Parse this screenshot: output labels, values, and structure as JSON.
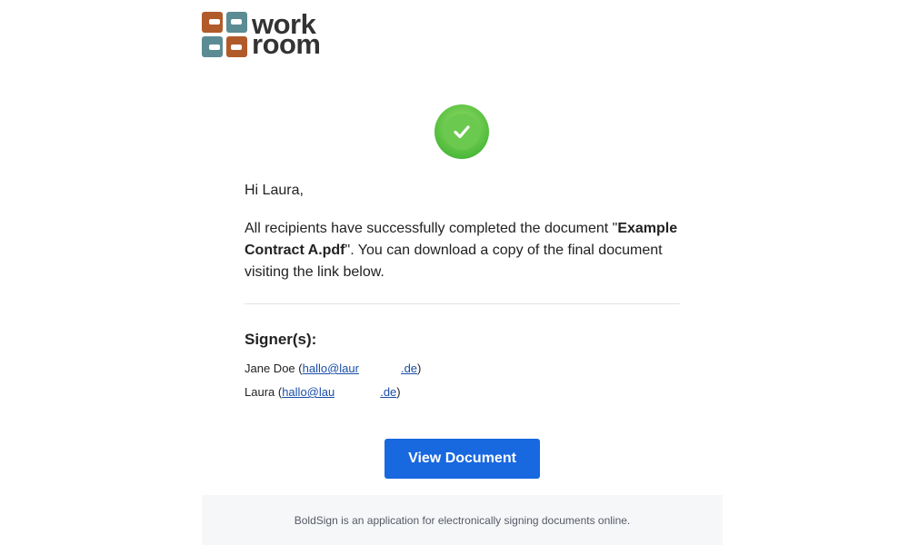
{
  "logo": {
    "line1": "work",
    "line2": "room",
    "colors": {
      "rust": "#b15a2a",
      "teal": "#5b8b93"
    }
  },
  "status_icon": "check-circle-icon",
  "greeting": "Hi Laura,",
  "message": {
    "before": "All recipients have successfully completed the document \"",
    "document_name": "Example Contract A.pdf",
    "after": "\". You can download a copy of the final document visiting the link below."
  },
  "signers": {
    "title": "Signer(s):",
    "list": [
      {
        "name": "Jane Doe",
        "email_start": "hallo@laur",
        "email_end": ".de"
      },
      {
        "name": "Laura",
        "email_start": "hallo@lau",
        "email_end": ".de"
      }
    ]
  },
  "button": {
    "label": "View Document",
    "color": "#1868e0"
  },
  "footer": {
    "text": "BoldSign is an application for electronically signing documents online."
  }
}
